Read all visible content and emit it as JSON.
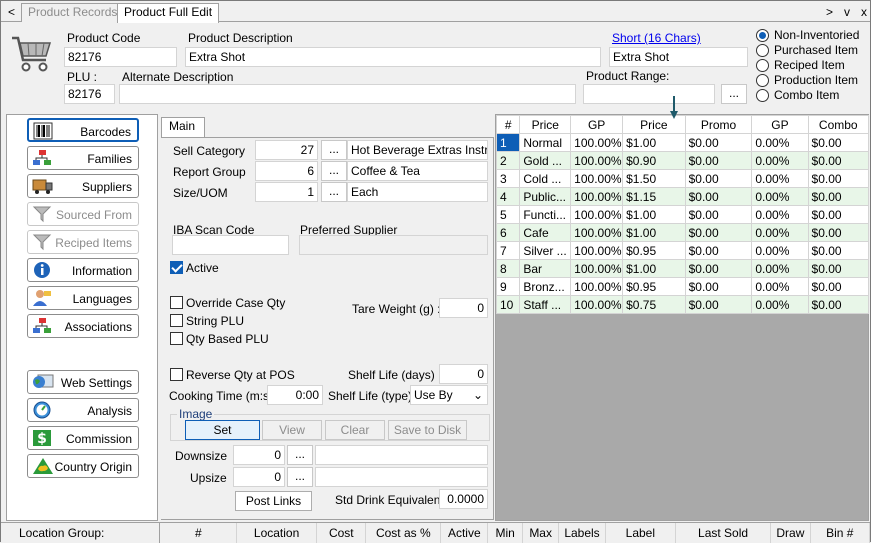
{
  "tabs": {
    "back": "<",
    "records": "Product Records",
    "full_edit": "Product Full Edit",
    "forward": ">",
    "down": "v",
    "close": "x"
  },
  "header": {
    "product_code_label": "Product Code",
    "product_code": "82176",
    "product_description_label": "Product Description",
    "product_description": "Extra Shot",
    "short_link": "Short (16 Chars)",
    "short_value": "Extra Shot",
    "plu_label": "PLU :",
    "plu": "82176",
    "alt_description_label": "Alternate Description",
    "alt_description": "",
    "product_range_label": "Product Range:",
    "product_range": "",
    "range_button": "...",
    "radios": [
      {
        "label": "Non-Inventoried",
        "selected": true
      },
      {
        "label": "Purchased Item",
        "selected": false
      },
      {
        "label": "Reciped Item",
        "selected": false
      },
      {
        "label": "Production Item",
        "selected": false
      },
      {
        "label": "Combo Item",
        "selected": false
      }
    ]
  },
  "sidebar": {
    "items": [
      {
        "label": "Barcodes",
        "icon": "barcode-icon",
        "enabled": true,
        "selected": true
      },
      {
        "label": "Families",
        "icon": "hierarchy-icon",
        "enabled": true
      },
      {
        "label": "Suppliers",
        "icon": "truck-icon",
        "enabled": true
      },
      {
        "label": "Sourced From",
        "icon": "funnel-icon",
        "enabled": false
      },
      {
        "label": "Reciped Items",
        "icon": "funnel-icon",
        "enabled": false
      },
      {
        "label": "Information",
        "icon": "info-icon",
        "enabled": true
      },
      {
        "label": "Languages",
        "icon": "person-icon",
        "enabled": true
      },
      {
        "label": "Associations",
        "icon": "hierarchy-icon",
        "enabled": true
      },
      {
        "label": "Web Settings",
        "icon": "globe-icon",
        "enabled": true
      },
      {
        "label": "Analysis",
        "icon": "gauge-icon",
        "enabled": true
      },
      {
        "label": "Commission",
        "icon": "dollar-icon",
        "enabled": true
      },
      {
        "label": "Country Origin",
        "icon": "australia-icon",
        "enabled": true
      }
    ]
  },
  "main": {
    "tab": "Main",
    "sell_category_label": "Sell Category",
    "sell_category_code": "27",
    "sell_category_name": "Hot Beverage Extras Instruct",
    "report_group_label": "Report Group",
    "report_group_code": "6",
    "report_group_name": "Coffee & Tea",
    "size_uom_label": "Size/UOM",
    "size_uom_code": "1",
    "size_uom_name": "Each",
    "ellipsis": "...",
    "iba_label": "IBA Scan Code",
    "iba_value": "",
    "preferred_supplier_label": "Preferred Supplier",
    "preferred_supplier": "",
    "active_label": "Active",
    "override_case_label": "Override Case Qty",
    "string_plu_label": "String PLU",
    "qty_based_plu_label": "Qty Based PLU",
    "tare_weight_label": "Tare Weight (g) :",
    "tare_weight": "0",
    "reverse_qty_label": "Reverse Qty at POS",
    "shelf_life_days_label": "Shelf Life (days) :",
    "shelf_life_days": "0",
    "cooking_time_label": "Cooking Time (m:s):",
    "cooking_time": "0:00",
    "shelf_life_type_label": "Shelf Life (type) :",
    "shelf_life_type": "Use By",
    "image_label": "Image",
    "set_btn": "Set",
    "view_btn": "View",
    "clear_btn": "Clear",
    "save_disk_btn": "Save to Disk",
    "downsize_label": "Downsize",
    "downsize": "0",
    "upsize_label": "Upsize",
    "upsize": "0",
    "post_links_btn": "Post Links",
    "std_drink_label": "Std Drink Equivalent:",
    "std_drink": "0.0000"
  },
  "price_table": {
    "headers": [
      "#",
      "Price",
      "GP",
      "Price",
      "Promo",
      "GP",
      "Combo"
    ],
    "rows": [
      [
        "1",
        "Normal",
        "100.00%",
        "$1.00",
        "$0.00",
        "0.00%",
        "$0.00"
      ],
      [
        "2",
        "Gold ...",
        "100.00%",
        "$0.90",
        "$0.00",
        "0.00%",
        "$0.00"
      ],
      [
        "3",
        "Cold ...",
        "100.00%",
        "$1.50",
        "$0.00",
        "0.00%",
        "$0.00"
      ],
      [
        "4",
        "Public...",
        "100.00%",
        "$1.15",
        "$0.00",
        "0.00%",
        "$0.00"
      ],
      [
        "5",
        "Functi...",
        "100.00%",
        "$1.00",
        "$0.00",
        "0.00%",
        "$0.00"
      ],
      [
        "6",
        "Cafe",
        "100.00%",
        "$1.00",
        "$0.00",
        "0.00%",
        "$0.00"
      ],
      [
        "7",
        "Silver ...",
        "100.00%",
        "$0.95",
        "$0.00",
        "0.00%",
        "$0.00"
      ],
      [
        "8",
        "Bar",
        "100.00%",
        "$1.00",
        "$0.00",
        "0.00%",
        "$0.00"
      ],
      [
        "9",
        "Bronz...",
        "100.00%",
        "$0.95",
        "$0.00",
        "0.00%",
        "$0.00"
      ],
      [
        "10",
        "Staff ...",
        "100.00%",
        "$0.75",
        "$0.00",
        "0.00%",
        "$0.00"
      ]
    ]
  },
  "bottom": {
    "location_group_label": "Location Group:",
    "headers": [
      "#",
      "Location",
      "Cost",
      "Cost as %",
      "Active",
      "Min",
      "Max",
      "Labels",
      "Label",
      "Last Sold",
      "Draw",
      "Bin #"
    ]
  },
  "colors": {
    "accent": "#0e5eb6",
    "row_alt": "#e8f6e8",
    "grid_bg": "#a9a9a9",
    "arrow": "#1f5a6a"
  }
}
